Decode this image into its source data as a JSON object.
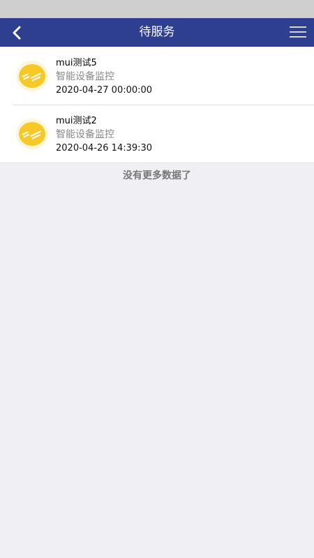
{
  "header": {
    "title": "待服务",
    "back_icon": "back-chevron-icon",
    "menu_icon": "hamburger-menu-icon",
    "bar_color": "#2f3f8f"
  },
  "list": {
    "items": [
      {
        "title": "mui测试5",
        "subtitle": "智能设备监控",
        "time": "2020-04-27 00:00:00",
        "avatar_icon": "device-monitor-badge-icon"
      },
      {
        "title": "mui测试2",
        "subtitle": "智能设备监控",
        "time": "2020-04-26 14:39:30",
        "avatar_icon": "device-monitor-badge-icon"
      }
    ]
  },
  "footer": {
    "no_more_text": "没有更多数据了"
  }
}
